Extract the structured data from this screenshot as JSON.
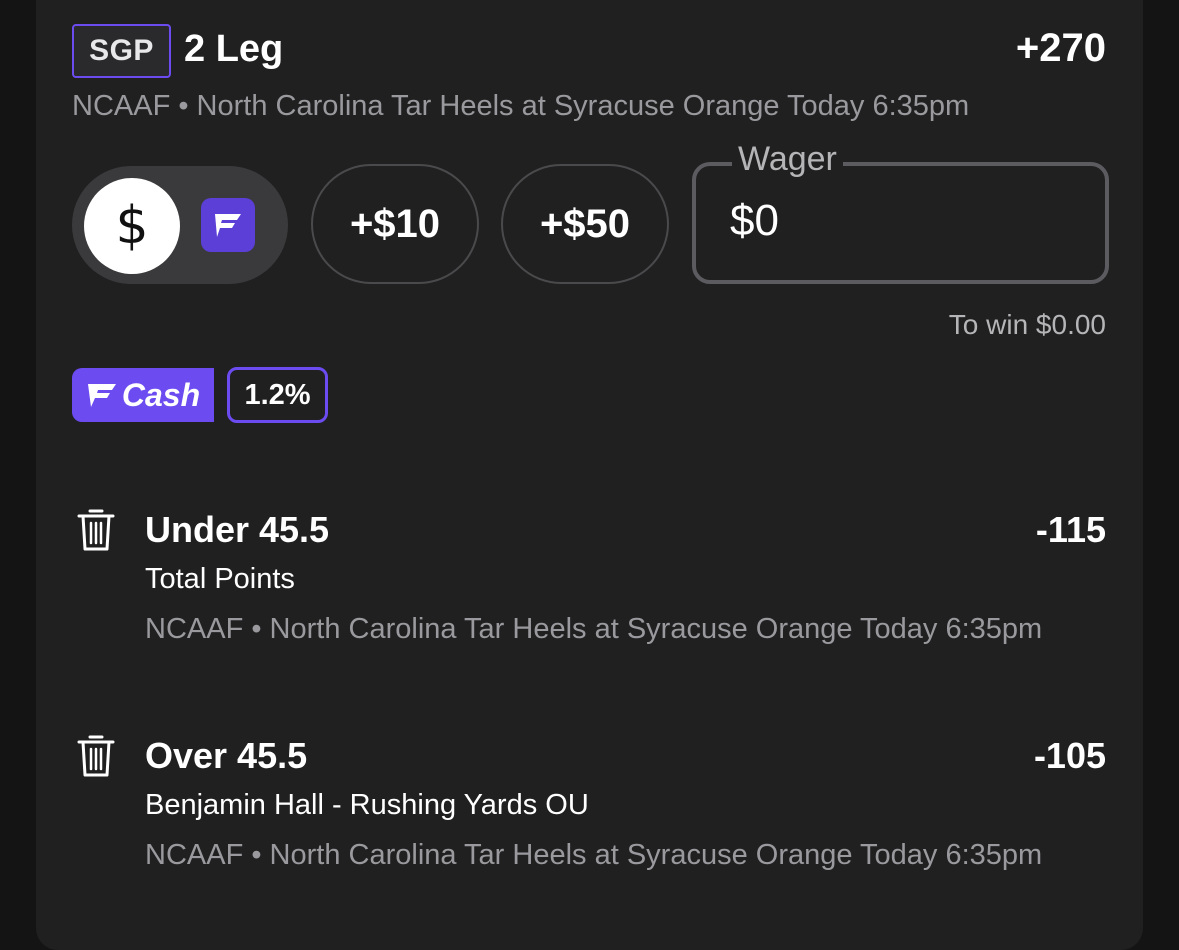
{
  "bet": {
    "sgp_badge": "SGP",
    "legs_title": "2 Leg",
    "total_odds": "+270",
    "event_line": "NCAAF • North Carolina Tar Heels at Syracuse Orange Today 6:35pm"
  },
  "wager": {
    "currency_toggle_symbol": "$",
    "chip_10": "+$10",
    "chip_50": "+$50",
    "label": "Wager",
    "value": "$0",
    "to_win": "To win $0.00"
  },
  "cash_promo": {
    "label": "Cash",
    "percent": "1.2%"
  },
  "legs": [
    {
      "title": "Under 45.5",
      "odds": "-115",
      "market": "Total Points",
      "event": "NCAAF • North Carolina Tar Heels at Syracuse Orange Today 6:35pm"
    },
    {
      "title": "Over 45.5",
      "odds": "-105",
      "market": "Benjamin Hall - Rushing Yards OU",
      "event": "NCAAF • North Carolina Tar Heels at Syracuse Orange Today 6:35pm"
    }
  ],
  "colors": {
    "accent": "#6c4cf0",
    "card_bg": "#202021",
    "page_bg": "#141414",
    "muted_text": "#9a9a9e"
  },
  "icons": {
    "toggle_cash": "dollar-icon",
    "toggle_fd": "fanduel-logo-icon",
    "remove_leg": "trash-icon",
    "cash_logo": "fanduel-f-icon"
  }
}
